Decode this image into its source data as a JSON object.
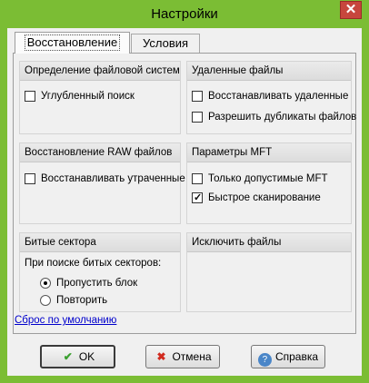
{
  "window": {
    "title": "Настройки",
    "close_symbol": "✕"
  },
  "tabs": [
    {
      "label": "Восстановление",
      "active": true
    },
    {
      "label": "Условия",
      "active": false
    }
  ],
  "groups": {
    "fs": {
      "title": "Определение файловой системы",
      "options": [
        {
          "label": "Углубленный поиск",
          "checked": false
        }
      ]
    },
    "deleted": {
      "title": "Удаленные файлы",
      "options": [
        {
          "label": "Восстанавливать удаленные",
          "checked": false
        },
        {
          "label": "Разрешить дубликаты файлов",
          "checked": false
        }
      ]
    },
    "raw": {
      "title": "Восстановление RAW файлов",
      "options": [
        {
          "label": "Восстанавливать утраченные",
          "checked": false
        }
      ]
    },
    "mft": {
      "title": "Параметры MFT",
      "options": [
        {
          "label": "Только допустимые MFT",
          "checked": false
        },
        {
          "label": "Быстрое сканирование",
          "checked": true
        }
      ]
    },
    "bad": {
      "title": "Битые сектора",
      "prompt": "При поиске битых секторов:",
      "options": [
        {
          "label": "Пропустить блок",
          "selected": true
        },
        {
          "label": "Повторить",
          "selected": false
        }
      ]
    },
    "exclude": {
      "title": "Исключить файлы"
    }
  },
  "reset_link": "Сброс по умолчанию",
  "buttons": {
    "ok": {
      "label": "OK",
      "icon": "checkmark-icon"
    },
    "cancel": {
      "label": "Отмена",
      "icon": "cross-icon"
    },
    "help": {
      "label": "Справка",
      "icon": "help-icon"
    }
  }
}
